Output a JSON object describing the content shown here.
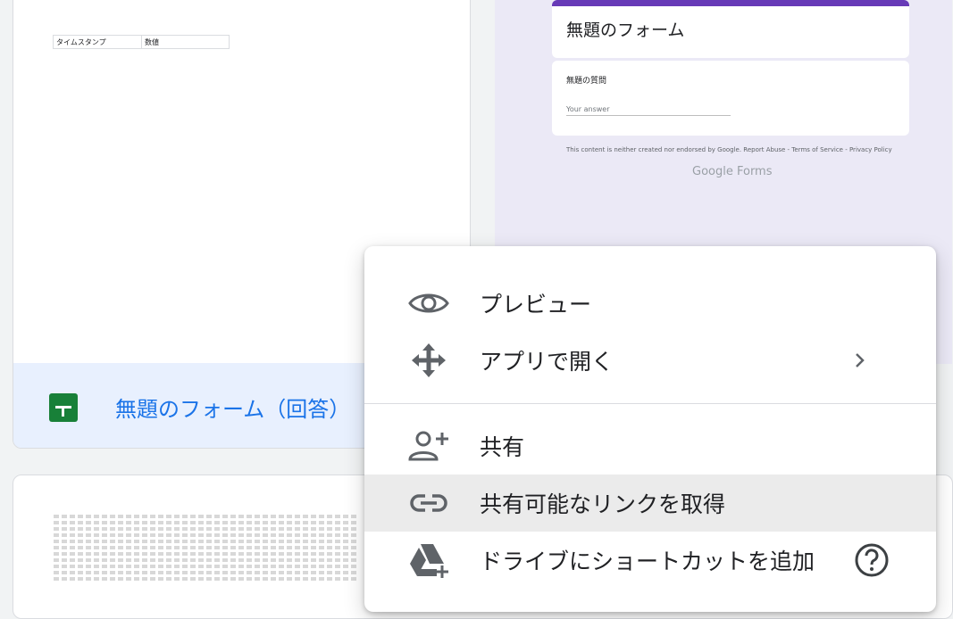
{
  "sheet_preview": {
    "col_a": "タイムスタンプ",
    "col_b": "数値"
  },
  "sheet_card": {
    "title": "無題のフォーム（回答）"
  },
  "form_preview": {
    "title": "無題のフォーム",
    "question": "無題の質問",
    "answer_placeholder": "Your answer",
    "disclaimer": "This content is neither created nor endorsed by Google. Report Abuse - Terms of Service - Privacy Policy",
    "brand": "Google Forms",
    "accent": "#673ab7"
  },
  "menu": {
    "items": [
      {
        "label": "プレビュー",
        "icon": "eye-icon"
      },
      {
        "label": "アプリで開く",
        "icon": "move-arrows-icon",
        "submenu": true
      },
      {
        "label": "共有",
        "icon": "person-add-icon"
      },
      {
        "label": "共有可能なリンクを取得",
        "icon": "link-icon",
        "highlighted": true
      },
      {
        "label": "ドライブにショートカットを追加",
        "icon": "drive-add-icon"
      }
    ],
    "help_icon": "help-circle-icon"
  }
}
